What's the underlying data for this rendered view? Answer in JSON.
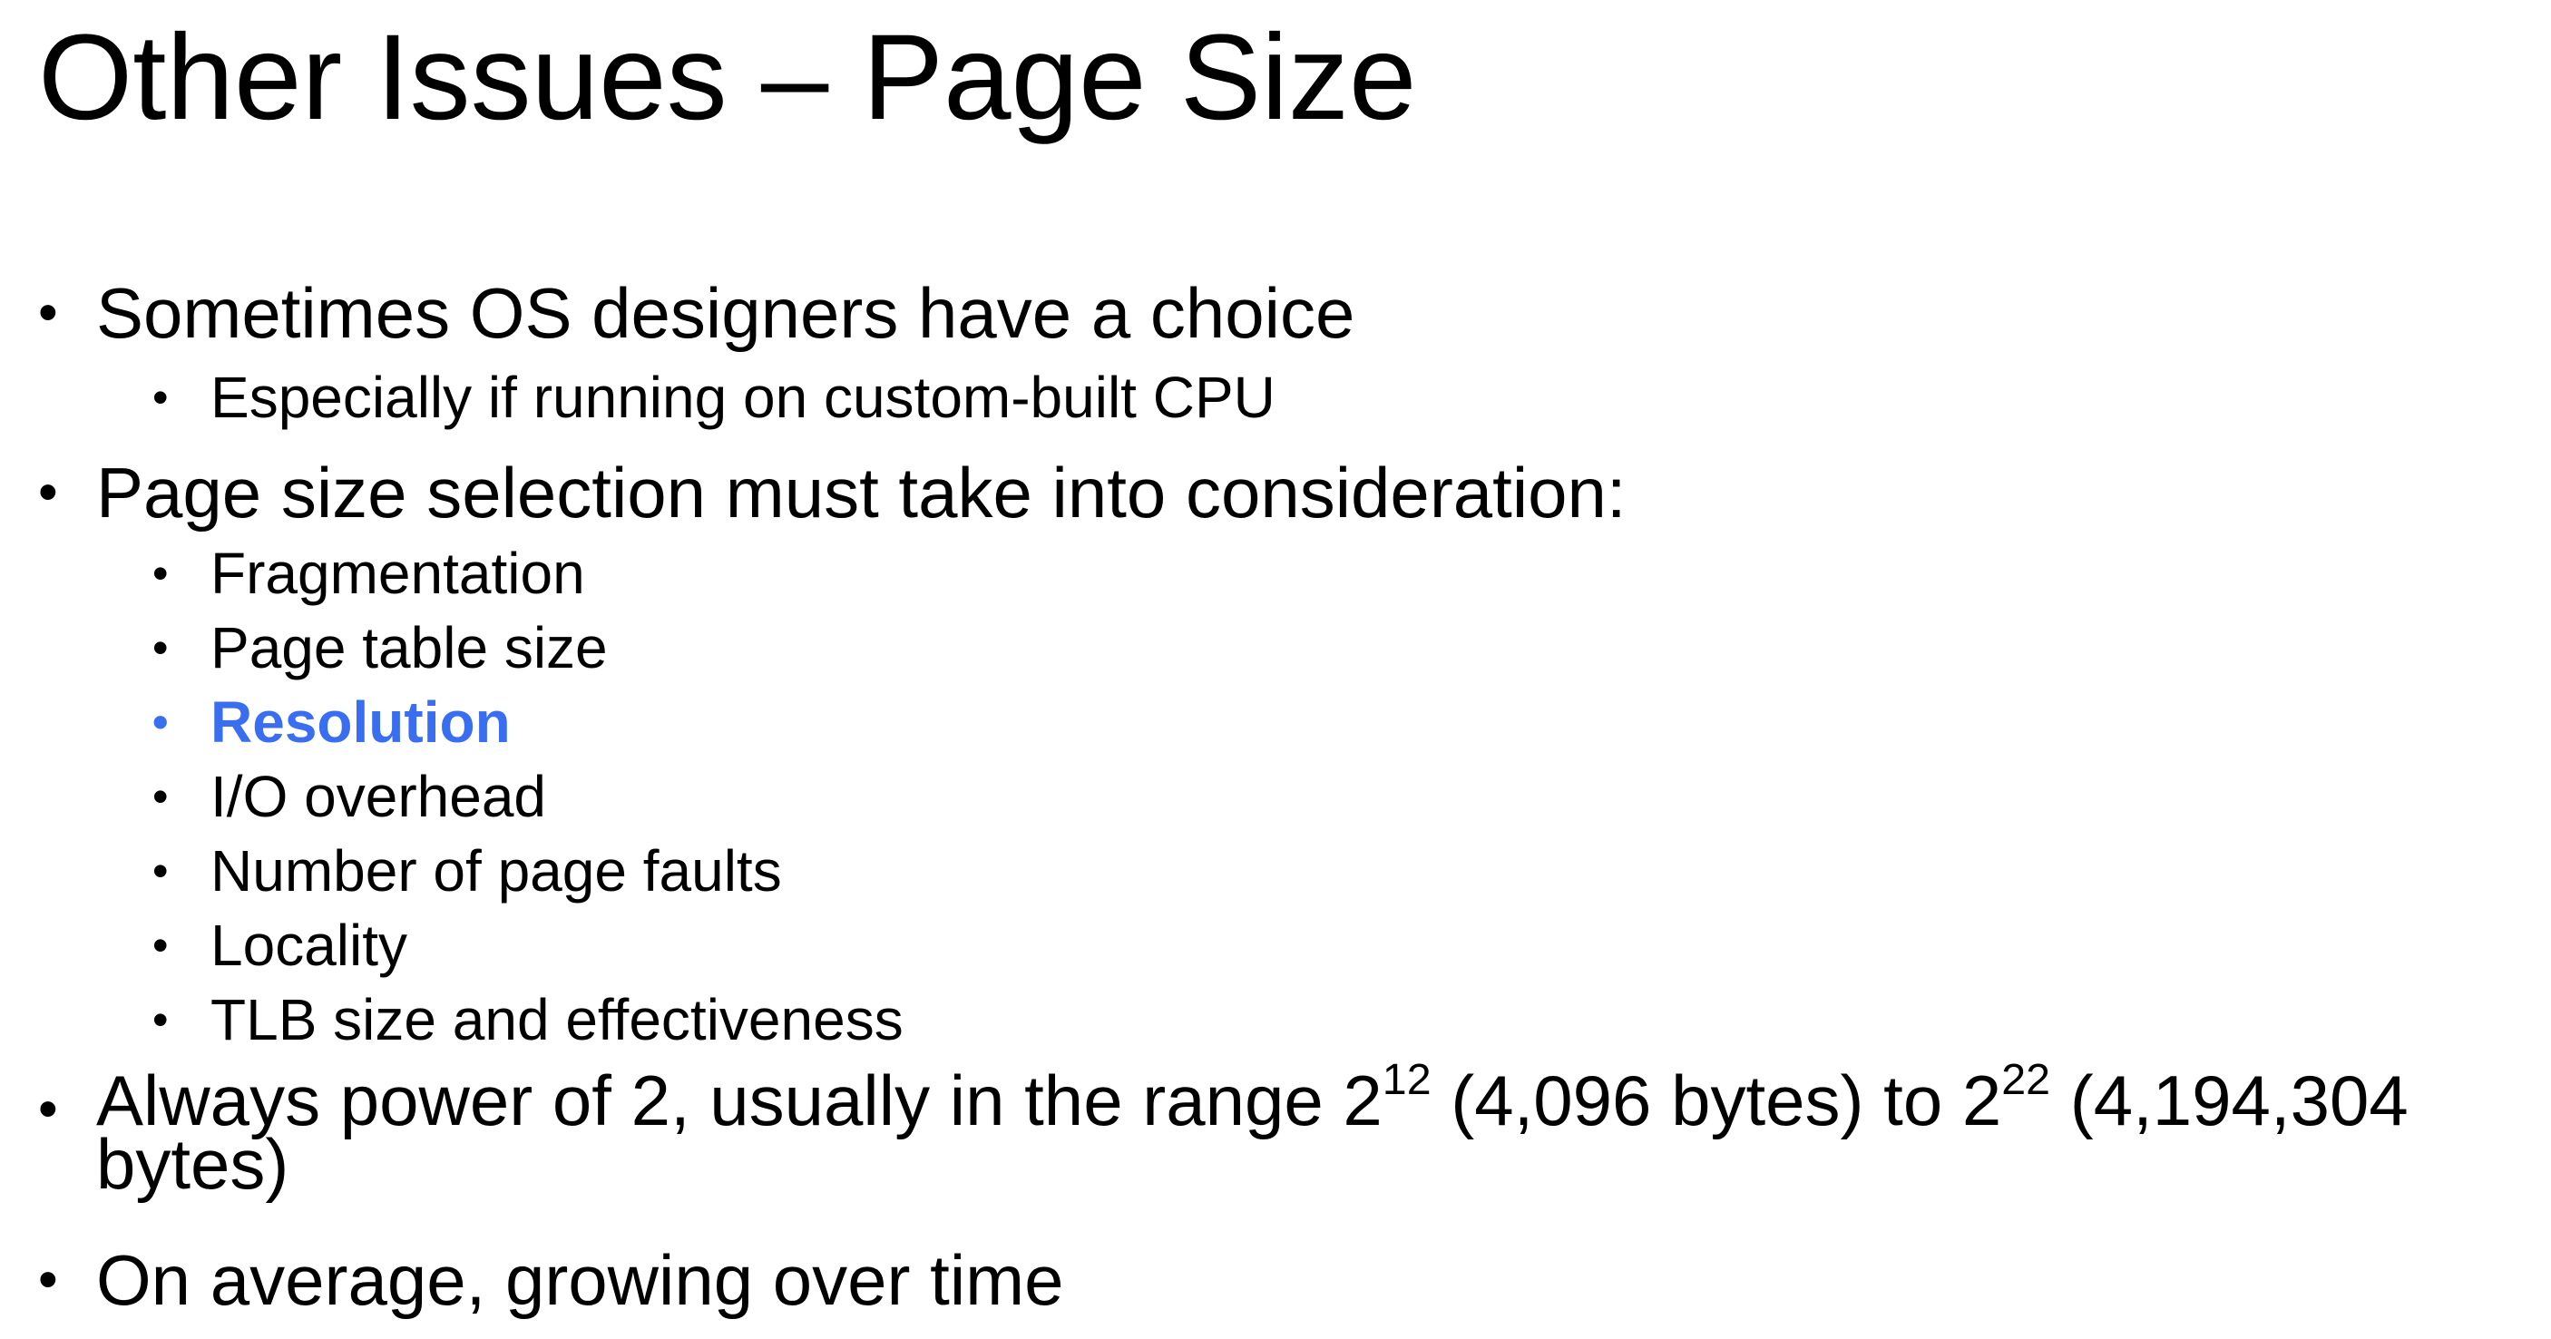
{
  "slide": {
    "title": "Other Issues – Page Size",
    "accent_color": "#3a6ef0",
    "bullets": [
      {
        "text": "Sometimes OS designers have a choice"
      },
      {
        "text": "Especially if running on custom-built CPU"
      },
      {
        "text": "Page size selection must take into consideration:"
      },
      {
        "text": "Fragmentation"
      },
      {
        "text": "Page table size"
      },
      {
        "text": "Resolution"
      },
      {
        "text": "I/O overhead"
      },
      {
        "text": "Number of page faults"
      },
      {
        "text": "Locality"
      },
      {
        "text": "TLB size and effectiveness"
      },
      {
        "text_part1": "Always power of 2, usually in the range 2",
        "exp1": "12",
        "text_part2": " (4,096 bytes) to 2",
        "exp2": "22",
        "text_part3": " (4,194,304",
        "text_part4": "bytes)"
      },
      {
        "text": "On average, growing over time"
      }
    ]
  }
}
